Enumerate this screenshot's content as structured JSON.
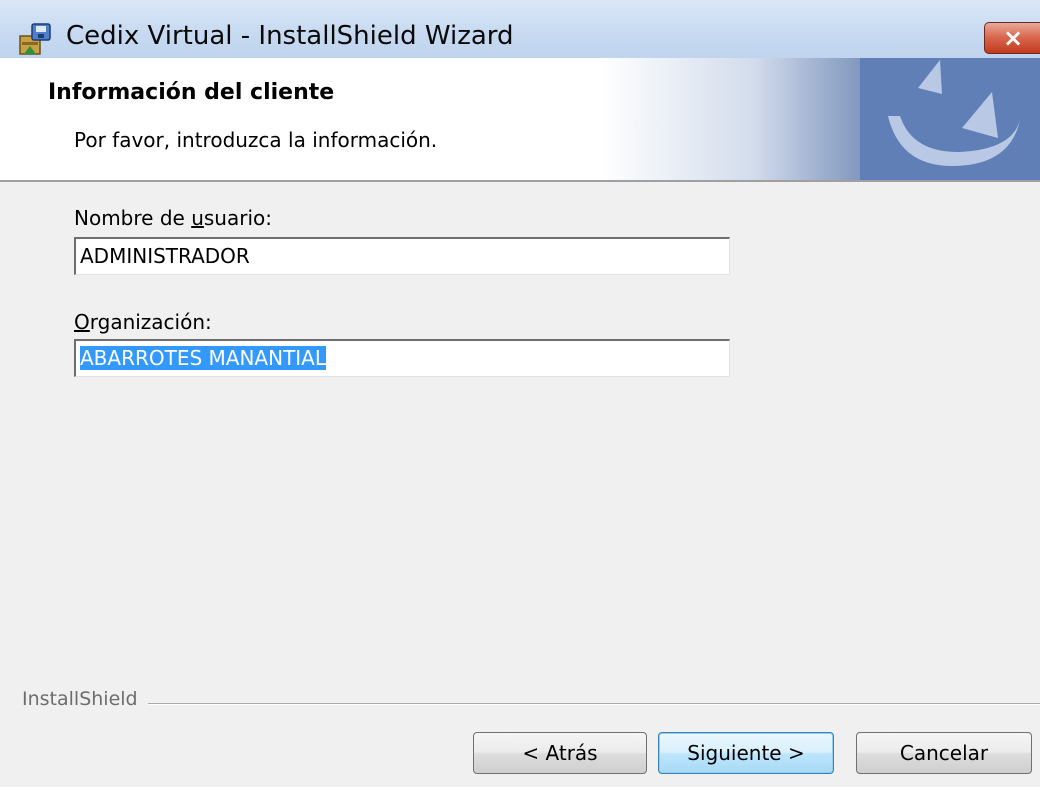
{
  "window": {
    "title": "Cedix Virtual - InstallShield Wizard",
    "close_glyph": "×"
  },
  "header": {
    "title": "Información del cliente",
    "subtitle": "Por favor, introduzca la información."
  },
  "form": {
    "username": {
      "label_prefix": "Nombre de ",
      "label_mnemonic": "u",
      "label_suffix": "suario:",
      "value": "ADMINISTRADOR"
    },
    "organization": {
      "label_prefix": "",
      "label_mnemonic": "O",
      "label_suffix": "rganización:",
      "value": "ABARROTES MANANTIAL"
    }
  },
  "footer": {
    "brand": "InstallShield",
    "back_label": "< Atrás",
    "next_label": "Siguiente >",
    "cancel_label": "Cancelar"
  },
  "icons": {
    "app": "installer-icon",
    "close": "close-icon",
    "banner": "installshield-logo-icon"
  },
  "colors": {
    "selection": "#3399ff",
    "title_bar": "#c6d9f1",
    "close_button": "#c2391e"
  }
}
